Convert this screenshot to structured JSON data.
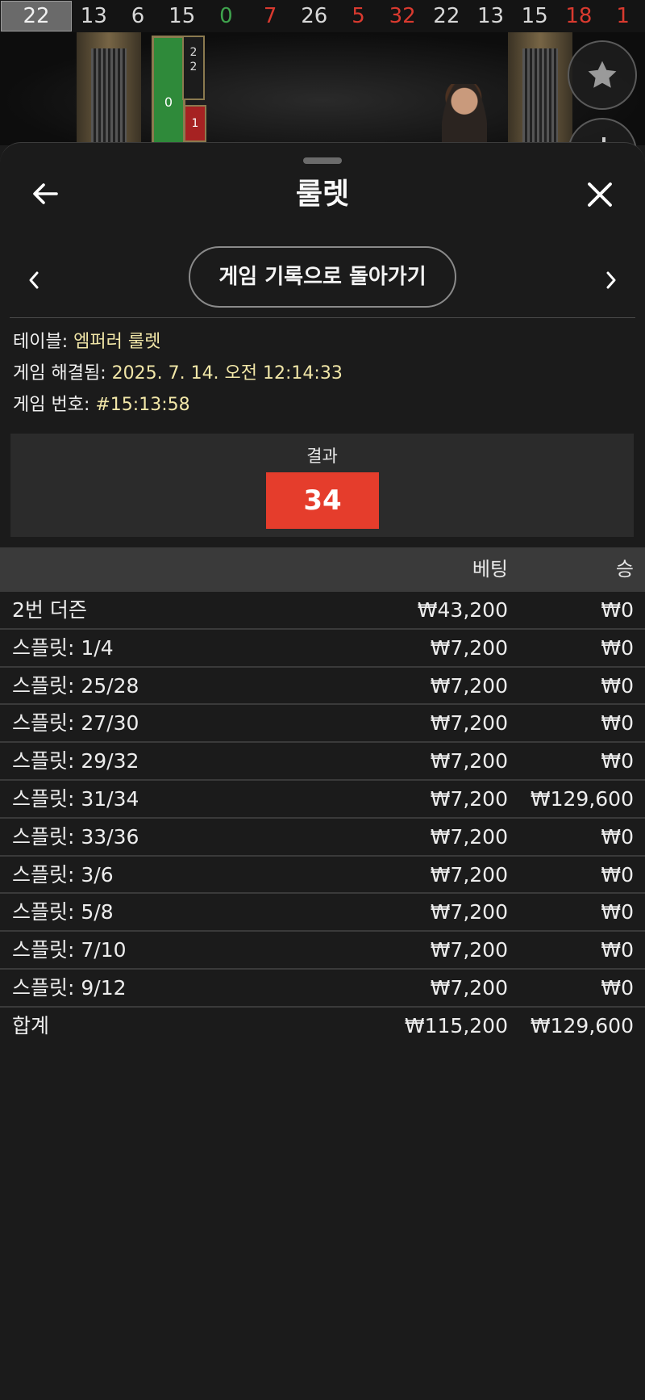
{
  "history": [
    {
      "n": "22",
      "color": "current"
    },
    {
      "n": "13",
      "color": "black"
    },
    {
      "n": "6",
      "color": "black"
    },
    {
      "n": "15",
      "color": "black"
    },
    {
      "n": "0",
      "color": "green"
    },
    {
      "n": "7",
      "color": "red"
    },
    {
      "n": "26",
      "color": "black"
    },
    {
      "n": "5",
      "color": "red"
    },
    {
      "n": "32",
      "color": "red"
    },
    {
      "n": "22",
      "color": "black"
    },
    {
      "n": "13",
      "color": "black"
    },
    {
      "n": "15",
      "color": "black"
    },
    {
      "n": "18",
      "color": "red"
    },
    {
      "n": "1",
      "color": "red"
    }
  ],
  "video": {
    "wheel_numbers": [
      "0",
      "2",
      "2",
      "1"
    ]
  },
  "header": {
    "title": "룰렛",
    "return_label": "게임 기록으로 돌아가기"
  },
  "info": {
    "table_label": "테이블:",
    "table_value": "엠퍼러 룰렛",
    "resolved_label": "게임 해결됨:",
    "resolved_value": "2025. 7. 14. 오전 12:14:33",
    "number_label": "게임 번호:",
    "number_value": "#15:13:58"
  },
  "result": {
    "label": "결과",
    "value": "34",
    "color": "#e53d2c"
  },
  "table": {
    "col_bet": "베팅",
    "col_win": "승",
    "rows": [
      {
        "name": "2번 더즌",
        "bet": "₩43,200",
        "win": "₩0"
      },
      {
        "name": "스플릿: 1/4",
        "bet": "₩7,200",
        "win": "₩0"
      },
      {
        "name": "스플릿: 25/28",
        "bet": "₩7,200",
        "win": "₩0"
      },
      {
        "name": "스플릿: 27/30",
        "bet": "₩7,200",
        "win": "₩0"
      },
      {
        "name": "스플릿: 29/32",
        "bet": "₩7,200",
        "win": "₩0"
      },
      {
        "name": "스플릿: 31/34",
        "bet": "₩7,200",
        "win": "₩129,600"
      },
      {
        "name": "스플릿: 33/36",
        "bet": "₩7,200",
        "win": "₩0"
      },
      {
        "name": "스플릿: 3/6",
        "bet": "₩7,200",
        "win": "₩0"
      },
      {
        "name": "스플릿: 5/8",
        "bet": "₩7,200",
        "win": "₩0"
      },
      {
        "name": "스플릿: 7/10",
        "bet": "₩7,200",
        "win": "₩0"
      },
      {
        "name": "스플릿: 9/12",
        "bet": "₩7,200",
        "win": "₩0"
      }
    ],
    "total": {
      "name": "합계",
      "bet": "₩115,200",
      "win": "₩129,600"
    }
  },
  "icons": {
    "back": "arrow-left-icon",
    "close": "close-icon",
    "prev": "chevron-left-icon",
    "next": "chevron-right-icon",
    "favorite": "star-icon"
  }
}
